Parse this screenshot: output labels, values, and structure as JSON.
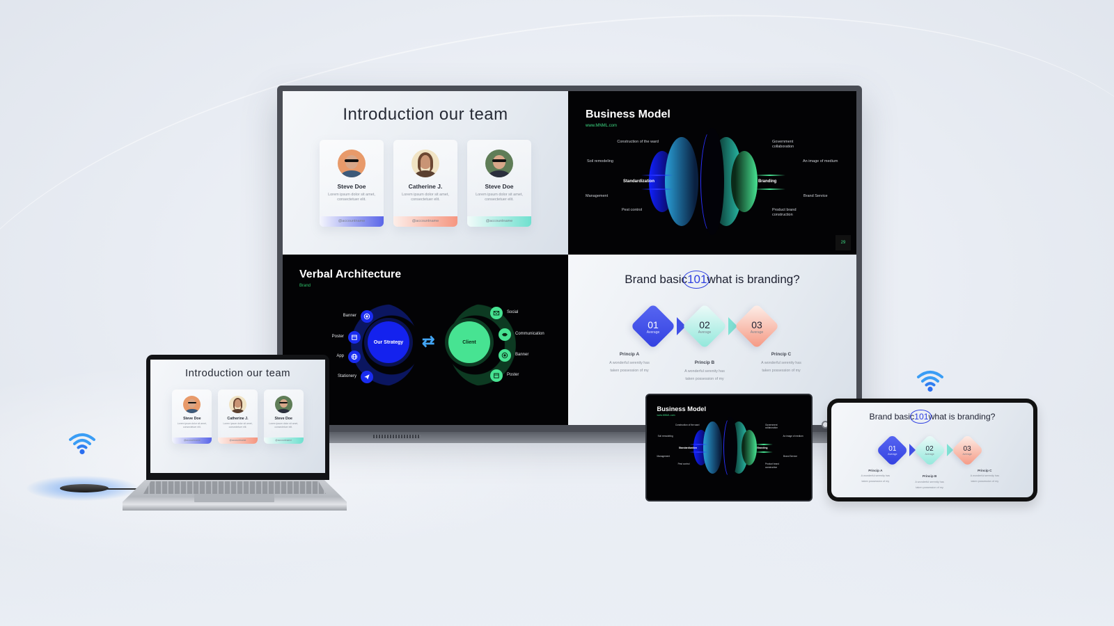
{
  "scene": {
    "description": "Wireless screen mirroring from multiple devices to a large display",
    "accent_colors": {
      "blue": "#1a2cf0",
      "green": "#47e392",
      "wifi": "#2f8cf0",
      "coral": "#f59680",
      "teal": "#6fe0cf"
    }
  },
  "slides": {
    "team": {
      "title": "Introduction our team",
      "members": [
        {
          "name": "Steve Doe",
          "desc": "Lorem ipsum dolor sit amet, consectetuer elit.",
          "account": "@accountname",
          "accent": "blue"
        },
        {
          "name": "Catherine J.",
          "desc": "Lorem ipsum dolor sit amet, consectetuer elit.",
          "account": "@accountname",
          "accent": "coral"
        },
        {
          "name": "Steve Doe",
          "desc": "Lorem ipsum dolor sit amet, consectetuer elit.",
          "account": "@accountname",
          "accent": "teal"
        }
      ]
    },
    "business": {
      "title": "Business Model",
      "url": "www.MNML.com",
      "left_key": "Standardization",
      "right_key": "Branding",
      "left_labels": [
        "Construction of the ward",
        "Soil remodeling",
        "Management",
        "Pest control"
      ],
      "right_labels": [
        "Government collaboration",
        "An image of medium",
        "Brand Service",
        "Product brand construction"
      ],
      "page_number": "29"
    },
    "verbal": {
      "title": "Verbal Architecture",
      "subtitle": "Brand",
      "strategy": "Our Strategy",
      "client": "Client",
      "left_items": [
        {
          "label": "Banner",
          "icon": "target-icon"
        },
        {
          "label": "Poster",
          "icon": "calendar-icon"
        },
        {
          "label": "App",
          "icon": "globe-icon"
        },
        {
          "label": "Stationery",
          "icon": "send-icon"
        }
      ],
      "right_items": [
        {
          "label": "Social",
          "icon": "mail-icon"
        },
        {
          "label": "Communication",
          "icon": "handshake-icon"
        },
        {
          "label": "Banner",
          "icon": "target-icon"
        },
        {
          "label": "Poster",
          "icon": "calendar-icon"
        }
      ]
    },
    "brand": {
      "title_before": "Brand basic",
      "title_highlight": "101",
      "title_after": "what is branding?",
      "steps": [
        {
          "num": "01",
          "sub": "Average",
          "title": "Princip A",
          "desc_1": "A wonderful serenity has",
          "desc_2": "taken possession of my"
        },
        {
          "num": "02",
          "sub": "Average",
          "title": "Princip B",
          "desc_1": "A wonderful serenity has",
          "desc_2": "taken possession of my"
        },
        {
          "num": "03",
          "sub": "Average",
          "title": "Princip C",
          "desc_1": "A wonderful serenity has",
          "desc_2": "taken possession of my"
        }
      ]
    }
  },
  "devices": {
    "monitor": "large-display",
    "laptop": "laptop-mirroring-team-slide",
    "tablet": "tablet-mirroring-business-slide",
    "phone": "phone-mirroring-brand-slide",
    "dongle": "wireless-transmitter"
  }
}
